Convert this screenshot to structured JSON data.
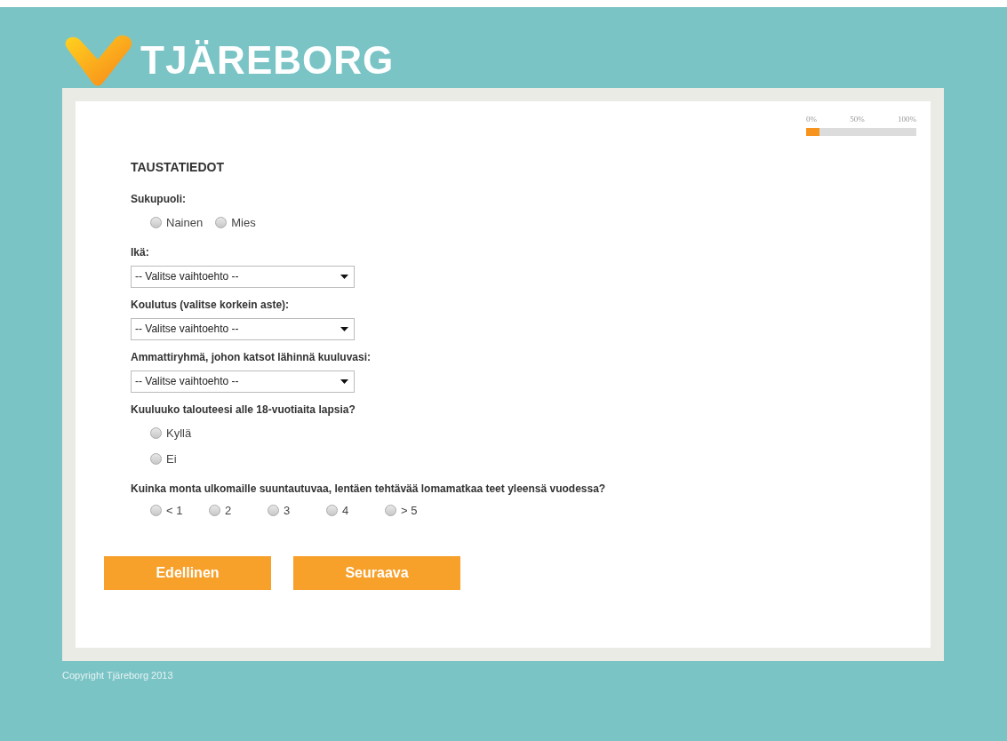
{
  "logo": {
    "text": "TJÄREBORG"
  },
  "progress": {
    "labels": [
      "0%",
      "50%",
      "100%"
    ],
    "level": 0.12
  },
  "section_title": "TAUSTATIEDOT",
  "questions": [
    {
      "kind": "radio",
      "label": "Sukupuoli:",
      "vertical": false,
      "options": [
        {
          "label": "Nainen",
          "selected": false
        },
        {
          "label": "Mies",
          "selected": false
        }
      ]
    },
    {
      "kind": "select",
      "label": "Ikä:",
      "value": "-- Valitse vaihtoehto --"
    },
    {
      "kind": "select",
      "label": "Koulutus (valitse korkein aste):",
      "value": "-- Valitse vaihtoehto --"
    },
    {
      "kind": "select",
      "label": "Ammattiryhmä, johon katsot lähinnä kuuluvasi:",
      "value": "-- Valitse vaihtoehto --"
    },
    {
      "kind": "radio",
      "label": "Kuuluuko talouteesi alle 18-vuotiaita lapsia?",
      "vertical": true,
      "options": [
        {
          "label": "Kyllä",
          "selected": false
        },
        {
          "label": "Ei",
          "selected": false
        }
      ]
    },
    {
      "kind": "radio",
      "label": "Kuinka monta ulkomaille suuntautuvaa, lentäen tehtävää lomamatkaa teet yleensä vuodessa?",
      "vertical": false,
      "options": [
        {
          "label": "< 1",
          "selected": false
        },
        {
          "label": "2",
          "selected": false
        },
        {
          "label": "3",
          "selected": false
        },
        {
          "label": "4",
          "selected": false
        },
        {
          "label": "> 5",
          "selected": false
        }
      ]
    }
  ],
  "buttons": [
    "Edellinen",
    "Seuraava"
  ],
  "footer": "Copyright Tjäreborg 2013"
}
